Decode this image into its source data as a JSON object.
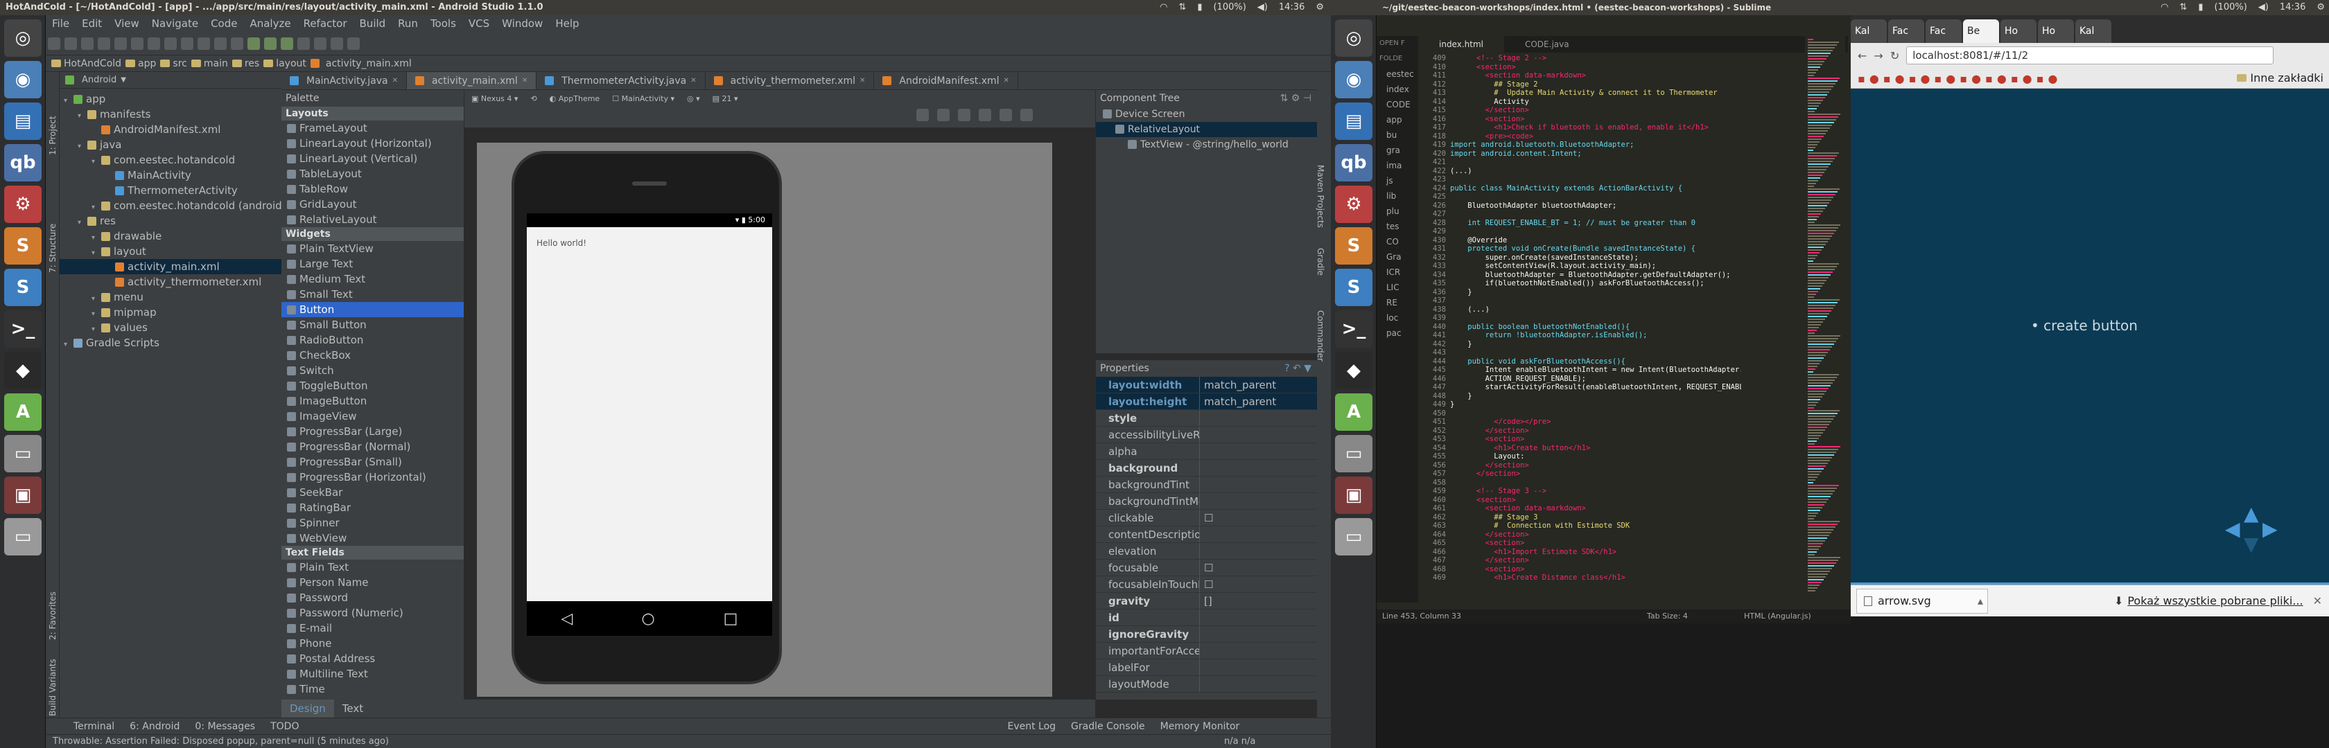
{
  "as": {
    "window_title": "HotAndCold - [~/HotAndCold] - [app] - .../app/src/main/res/layout/activity_main.xml - Android Studio 1.1.0",
    "tray": {
      "battery": "(100%)",
      "battery2": "(100%)",
      "time": "14:36",
      "time2": "14:36"
    },
    "menu": [
      "File",
      "Edit",
      "View",
      "Navigate",
      "Code",
      "Analyze",
      "Refactor",
      "Build",
      "Run",
      "Tools",
      "VCS",
      "Window",
      "Help"
    ],
    "breadcrumbs": [
      "HotAndCold",
      "app",
      "src",
      "main",
      "res",
      "layout",
      "activity_main.xml"
    ],
    "project_view": "Android",
    "tree": [
      {
        "label": "app",
        "indent": 0,
        "icon": "module"
      },
      {
        "label": "manifests",
        "indent": 1,
        "icon": "folder"
      },
      {
        "label": "AndroidManifest.xml",
        "indent": 2,
        "icon": "xml"
      },
      {
        "label": "java",
        "indent": 1,
        "icon": "folder"
      },
      {
        "label": "com.eestec.hotandcold",
        "indent": 2,
        "icon": "package"
      },
      {
        "label": "MainActivity",
        "indent": 3,
        "icon": "class"
      },
      {
        "label": "ThermometerActivity",
        "indent": 3,
        "icon": "class"
      },
      {
        "label": "com.eestec.hotandcold (androidT",
        "indent": 2,
        "icon": "package"
      },
      {
        "label": "res",
        "indent": 1,
        "icon": "folder"
      },
      {
        "label": "drawable",
        "indent": 2,
        "icon": "folder"
      },
      {
        "label": "layout",
        "indent": 2,
        "icon": "folder"
      },
      {
        "label": "activity_main.xml",
        "indent": 3,
        "icon": "xml",
        "selected": true
      },
      {
        "label": "activity_thermometer.xml",
        "indent": 3,
        "icon": "xml"
      },
      {
        "label": "menu",
        "indent": 2,
        "icon": "folder"
      },
      {
        "label": "mipmap",
        "indent": 2,
        "icon": "folder"
      },
      {
        "label": "values",
        "indent": 2,
        "icon": "folder"
      },
      {
        "label": "Gradle Scripts",
        "indent": 0,
        "icon": "gradle"
      }
    ],
    "editor_tabs": [
      {
        "label": "MainActivity.java"
      },
      {
        "label": "activity_main.xml",
        "active": true
      },
      {
        "label": "ThermometerActivity.java"
      },
      {
        "label": "activity_thermometer.xml"
      },
      {
        "label": "AndroidManifest.xml"
      }
    ],
    "palette": {
      "title": "Palette",
      "groups": [
        {
          "name": "Layouts",
          "items": [
            "FrameLayout",
            "LinearLayout (Horizontal)",
            "LinearLayout (Vertical)",
            "TableLayout",
            "TableRow",
            "GridLayout",
            "RelativeLayout"
          ]
        },
        {
          "name": "Widgets",
          "items": [
            "Plain TextView",
            "Large Text",
            "Medium Text",
            "Small Text",
            "Button",
            "Small Button",
            "RadioButton",
            "CheckBox",
            "Switch",
            "ToggleButton",
            "ImageButton",
            "ImageView",
            "ProgressBar (Large)",
            "ProgressBar (Normal)",
            "ProgressBar (Small)",
            "ProgressBar (Horizontal)",
            "SeekBar",
            "RatingBar",
            "Spinner",
            "WebView"
          ]
        },
        {
          "name": "Text Fields",
          "items": [
            "Plain Text",
            "Person Name",
            "Password",
            "Password (Numeric)",
            "E-mail",
            "Phone",
            "Postal Address",
            "Multiline Text",
            "Time"
          ]
        }
      ],
      "selected": "Button"
    },
    "design_toolbar": {
      "device": "Nexus 4",
      "theme": "AppTheme",
      "activity": "MainActivity",
      "api": "21"
    },
    "phone": {
      "status_time": "5:00",
      "hello": "Hello world!"
    },
    "component_tree": {
      "title": "Component Tree",
      "items": [
        {
          "label": "Device Screen",
          "indent": 0
        },
        {
          "label": "RelativeLayout",
          "indent": 1,
          "selected": true
        },
        {
          "label": "TextView - @string/hello_world",
          "indent": 2
        }
      ]
    },
    "properties": {
      "title": "Properties",
      "rows": [
        {
          "k": "layout:width",
          "v": "match_parent",
          "hl": true
        },
        {
          "k": "layout:height",
          "v": "match_parent",
          "hl": true
        },
        {
          "k": "style",
          "v": "",
          "b": true
        },
        {
          "k": "accessibilityLiveReg",
          "v": ""
        },
        {
          "k": "alpha",
          "v": ""
        },
        {
          "k": "background",
          "v": "",
          "b": true
        },
        {
          "k": "backgroundTint",
          "v": ""
        },
        {
          "k": "backgroundTintMo",
          "v": ""
        },
        {
          "k": "clickable",
          "v": "☐"
        },
        {
          "k": "contentDescription",
          "v": ""
        },
        {
          "k": "elevation",
          "v": ""
        },
        {
          "k": "focusable",
          "v": "☐"
        },
        {
          "k": "focusableInTouchM",
          "v": "☐"
        },
        {
          "k": "gravity",
          "v": "[]",
          "b": true
        },
        {
          "k": "id",
          "v": "",
          "b": true
        },
        {
          "k": "ignoreGravity",
          "v": "",
          "b": true
        },
        {
          "k": "importantForAcces",
          "v": ""
        },
        {
          "k": "labelFor",
          "v": ""
        },
        {
          "k": "layoutMode",
          "v": ""
        }
      ]
    },
    "design_tabs": [
      "Design",
      "Text"
    ],
    "bottom_tools": [
      "Terminal",
      "6: Android",
      "0: Messages",
      "TODO",
      "Event Log",
      "Gradle Console",
      "Memory Monitor"
    ],
    "status": "Throwable: Assertion Failed: Disposed popup, parent=null (5 minutes ago)",
    "status_right": "n/a   n/a",
    "side_left": [
      "1: Project",
      "7: Structure",
      "2: Favorites",
      "Build Variants"
    ],
    "side_right": [
      "Maven Projects",
      "Gradle",
      "Commander"
    ]
  },
  "sublime": {
    "title": "~/git/eestec-beacon-workshops/index.html • (eestec-beacon-workshops) - Sublime",
    "tabs": [
      "index.html",
      "CODE.java"
    ],
    "sidebar": [
      "OPEN F",
      "FOLDE",
      "eestec",
      "index",
      "CODE",
      "app",
      "bu",
      "gra",
      "ima",
      "js",
      "lib",
      "plu",
      "tes",
      "CO",
      "Gra",
      "ICR",
      "LIC",
      "RE",
      "loc",
      "pac"
    ],
    "status_left": "Line 453, Column 33",
    "status_mid": "Tab Size: 4",
    "status_right": "HTML (Angular.js)",
    "first_line": 409,
    "code_lines": [
      "      <!-- Stage 2 -->",
      "      <section>",
      "        <section data-markdown>",
      "          ## Stage 2",
      "          #  Update Main Activity & connect it to Thermometer",
      "          Activity",
      "        </section>",
      "        <section>",
      "          <h1>Check if bluetooth is enabled, enable it</h1>",
      "        <pre><code>",
      "import android.bluetooth.BluetoothAdapter;",
      "import android.content.Intent;",
      "",
      "(...)",
      "",
      "public class MainActivity extends ActionBarActivity {",
      "",
      "    BluetoothAdapter bluetoothAdapter;",
      "",
      "    int REQUEST_ENABLE_BT = 1; // must be greater than 0",
      "",
      "    @Override",
      "    protected void onCreate(Bundle savedInstanceState) {",
      "        super.onCreate(savedInstanceState);",
      "        setContentView(R.layout.activity_main);",
      "        bluetoothAdapter = BluetoothAdapter.getDefaultAdapter();",
      "        if(bluetoothNotEnabled()) askForBluetoothAccess();",
      "    }",
      "",
      "    (...)",
      "",
      "    public boolean bluetoothNotEnabled(){",
      "        return !bluetoothAdapter.isEnabled();",
      "    }",
      "",
      "    public void askForBluetoothAccess(){",
      "        Intent enableBluetoothIntent = new Intent(BluetoothAdapter.",
      "        ACTION_REQUEST_ENABLE);",
      "        startActivityForResult(enableBluetoothIntent, REQUEST_ENABLE_BT);",
      "    }",
      "}",
      "",
      "          </code></pre>",
      "        </section>",
      "        <section>",
      "          <h1>Create button</h1>",
      "          Layout:",
      "        </section>",
      "      </section>",
      "",
      "      <!-- Stage 3 -->",
      "      <section>",
      "        <section data-markdown>",
      "          ## Stage 3",
      "          #  Connection with Estimote SDK",
      "        </section>",
      "        <section>",
      "          <h1>Import Estimote SDK</h1>",
      "        </section>",
      "        <section>",
      "          <h1>Create Distance class</h1>"
    ]
  },
  "browser": {
    "tabs": [
      "Kal",
      "Fac",
      "Fac",
      "Be",
      "Ho",
      "Ho",
      "Kal"
    ],
    "url": "localhost:8081/#/11/2",
    "bookmarks_other": "Inne zakładki",
    "slide_bullet": "create button",
    "download_file": "arrow.svg",
    "show_all": "Pokaż wszystkie pobrane pliki...",
    "close": "✕"
  },
  "colors": {
    "as_bg": "#2b2b2b",
    "panel": "#3c3f41",
    "selection": "#2f65ca",
    "slide_bg": "#0b3a55",
    "accent_blue": "#4a9ad9"
  }
}
